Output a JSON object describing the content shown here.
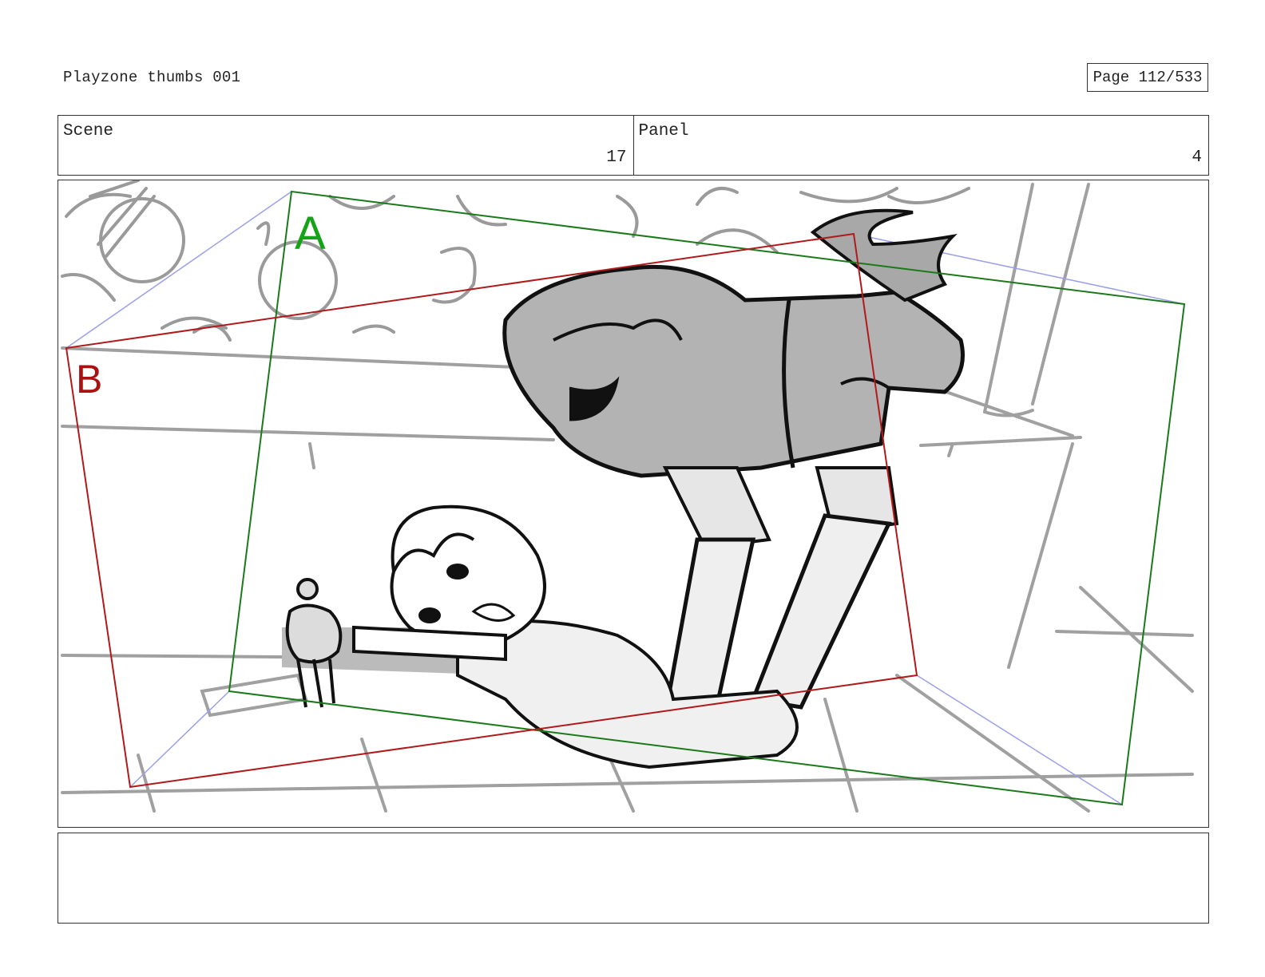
{
  "header": {
    "title": "Playzone thumbs 001",
    "page_label": "Page 112/533"
  },
  "info": {
    "scene_label": "Scene",
    "scene_value": "17",
    "panel_label": "Panel",
    "panel_value": "4"
  },
  "frame": {
    "camera_a_label": "A",
    "camera_b_label": "B",
    "colors": {
      "camera_a": "#1a7a1a",
      "camera_b": "#b01a1a",
      "camera_a_text": "#17a317",
      "camera_b_text": "#aa1111",
      "move_path": "#9aa0e8"
    }
  },
  "notes": {
    "text": ""
  }
}
